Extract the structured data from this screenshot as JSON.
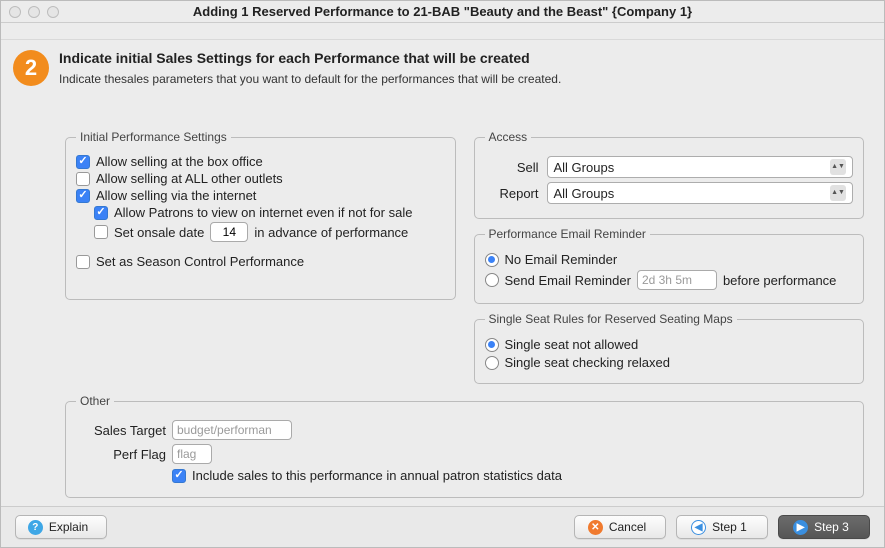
{
  "window": {
    "title": "Adding 1 Reserved Performance to 21-BAB \"Beauty and the Beast\" {Company 1}"
  },
  "step": {
    "number": "2",
    "heading": "Indicate initial Sales Settings for each Performance that will be created",
    "sub": "Indicate thesales parameters that you want to default for the performances that will be created."
  },
  "ips": {
    "legend": "Initial Performance Settings",
    "allow_box_office": "Allow selling at the box office",
    "allow_outlets": "Allow selling at ALL other outlets",
    "allow_internet": "Allow selling via the internet",
    "allow_view": "Allow Patrons to view on internet even if not for sale",
    "onsale_prefix": "Set onsale date",
    "onsale_value": "14",
    "onsale_suffix": "in advance of performance",
    "season_control": "Set as Season Control Performance"
  },
  "access": {
    "legend": "Access",
    "sell_label": "Sell",
    "sell_value": "All Groups",
    "report_label": "Report",
    "report_value": "All Groups"
  },
  "reminder": {
    "legend": "Performance Email Reminder",
    "none": "No Email Reminder",
    "send": "Send Email Reminder",
    "duration_placeholder": "2d 3h 5m",
    "suffix": "before performance"
  },
  "single_seat": {
    "legend": "Single Seat Rules for Reserved Seating Maps",
    "not_allowed": "Single seat not allowed",
    "relaxed": "Single seat checking relaxed"
  },
  "other": {
    "legend": "Other",
    "target_label": "Sales Target",
    "target_placeholder": "budget/performan",
    "flag_label": "Perf Flag",
    "flag_placeholder": "flag",
    "include_stats": "Include sales to this performance in annual patron statistics data"
  },
  "buttons": {
    "explain": "Explain",
    "cancel": "Cancel",
    "step1": "Step 1",
    "step3": "Step 3"
  }
}
